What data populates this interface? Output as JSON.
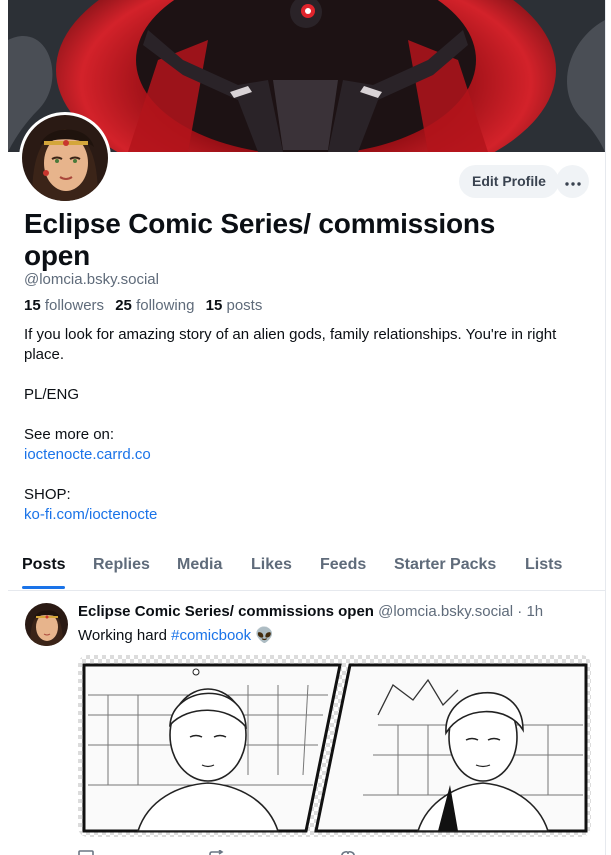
{
  "profile": {
    "display_name": "Eclipse Comic Series/ commissions open",
    "handle": "@lomcia.bsky.social",
    "edit_button": "Edit Profile",
    "more_icon": "more-horizontal-icon",
    "followers_count": "15",
    "followers_label": "followers",
    "following_count": "25",
    "following_label": "following",
    "posts_count": "15",
    "posts_label": "posts",
    "bio_line1": "If you look for amazing story of an alien gods, family relationships. You're in right place.",
    "bio_line2": "PL/ENG",
    "bio_line3": "See more on:",
    "bio_link1": "ioctenocte.carrd.co",
    "bio_line4": "SHOP:",
    "bio_link2": "ko-fi.com/ioctenocte"
  },
  "tabs": [
    "Posts",
    "Replies",
    "Media",
    "Likes",
    "Feeds",
    "Starter Packs",
    "Lists"
  ],
  "active_tab": "Posts",
  "post": {
    "author": "Eclipse Comic Series/ commissions open",
    "handle": "@lomcia.bsky.social",
    "separator": "·",
    "time": "1h",
    "text": "Working hard",
    "hashtag": "#comicbook",
    "emoji": "👽"
  },
  "colors": {
    "accent": "#1a73e8",
    "text": "#0b0f14",
    "muted": "#5f6b7a",
    "banner_red": "#c8161d"
  }
}
